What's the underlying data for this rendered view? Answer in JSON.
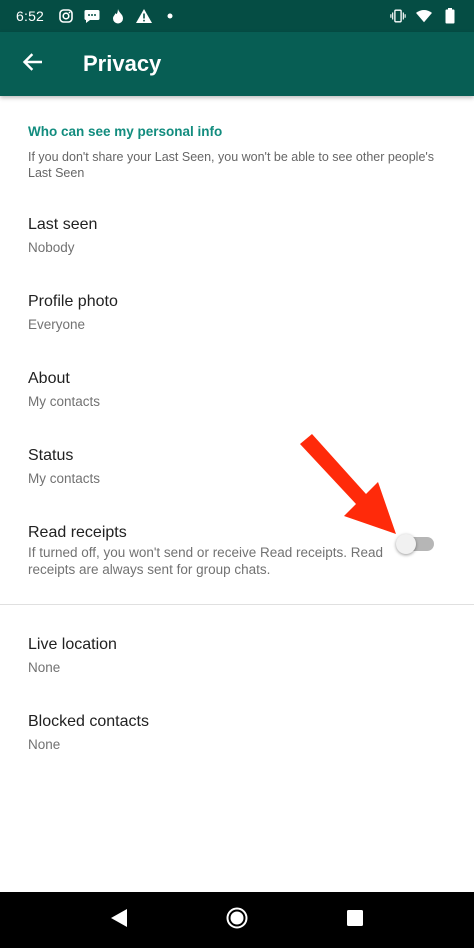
{
  "status_bar": {
    "time": "6:52",
    "left_icons": [
      "instagram-icon",
      "chat-bubble-icon",
      "flame-icon",
      "warning-icon",
      "dot-icon"
    ],
    "right_icons": [
      "vibrate-icon",
      "wifi-icon",
      "battery-icon"
    ]
  },
  "app_bar": {
    "title": "Privacy",
    "color": "#075e54"
  },
  "section": {
    "header": "Who can see my personal info",
    "note": "If you don't share your Last Seen, you won't be able to see other people's Last Seen",
    "accent": "#128c7e"
  },
  "items": [
    {
      "title": "Last seen",
      "value": "Nobody"
    },
    {
      "title": "Profile photo",
      "value": "Everyone"
    },
    {
      "title": "About",
      "value": "My contacts"
    },
    {
      "title": "Status",
      "value": "My contacts"
    }
  ],
  "read_receipts": {
    "title": "Read receipts",
    "description": "If turned off, you won't send or receive Read receipts. Read receipts are always sent for group chats.",
    "enabled": false
  },
  "items_after": [
    {
      "title": "Live location",
      "value": "None"
    },
    {
      "title": "Blocked contacts",
      "value": "None"
    }
  ],
  "annotation": {
    "arrow_color": "#ff2a0a"
  },
  "nav_bar": {
    "buttons": [
      "back-triangle-icon",
      "home-circle-icon",
      "recents-square-icon"
    ]
  }
}
